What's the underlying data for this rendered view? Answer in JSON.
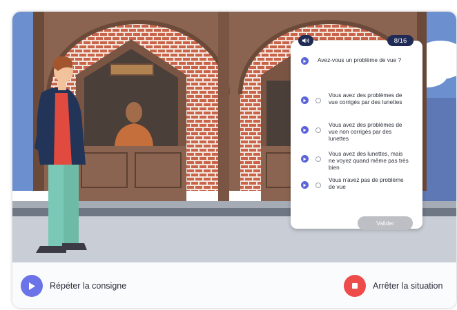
{
  "colors": {
    "accent": "#6a73e8",
    "stop": "#ee4b4b",
    "navy": "#1f2a55",
    "brick": "#b7583b",
    "sky": "#6c8fd0"
  },
  "panel": {
    "audio_icon": "speaker-icon",
    "progress": "8/16",
    "question": "Avez-vous un problème de vue ?",
    "options": [
      "Vous avez des problèmes de vue corrigés par des lunettes",
      "Vous avez des problèmes de vue non corrigés par des lunettes",
      "Vous avez des lunettes, mais ne voyez quand même pas très bien",
      "Vous n'avez pas de problème de vue"
    ],
    "validate_label": "Valider"
  },
  "controls": {
    "replay_label": "Répéter la consigne",
    "stop_label": "Arrêter la situation"
  }
}
